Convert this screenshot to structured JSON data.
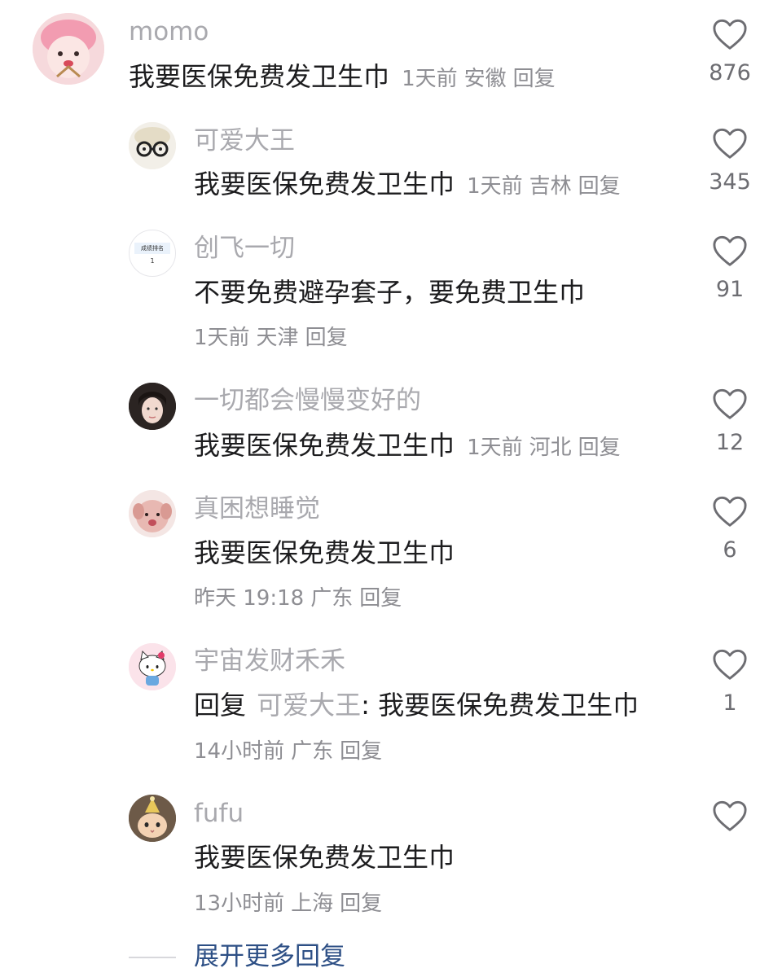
{
  "comments": [
    {
      "username": "momo",
      "avatar": "pink-character-avatar",
      "text": "我要医保免费发卫生巾",
      "time": "1天前",
      "location": "安徽",
      "reply_label": "回复",
      "likes": "876"
    },
    {
      "username": "可爱大王",
      "avatar": "glasses-face-avatar",
      "text": "我要医保免费发卫生巾",
      "time": "1天前",
      "location": "吉林",
      "reply_label": "回复",
      "likes": "345"
    },
    {
      "username": "创飞一切",
      "avatar": "ranking-card-avatar",
      "avatar_card_title": "成绩排名",
      "avatar_card_number": "1",
      "text": "不要免费避孕套子，要免费卫生巾",
      "time": "1天前",
      "location": "天津",
      "reply_label": "回复",
      "likes": "91"
    },
    {
      "username": "一切都会慢慢变好的",
      "avatar": "girl-photo-avatar",
      "text": "我要医保免费发卫生巾",
      "time": "1天前",
      "location": "河北",
      "reply_label": "回复",
      "likes": "12"
    },
    {
      "username": "真困想睡觉",
      "avatar": "pink-dog-avatar",
      "text": "我要医保免费发卫生巾",
      "time": "昨天 19:18",
      "location": "广东",
      "reply_label": "回复",
      "likes": "6"
    },
    {
      "username": "宇宙发财禾禾",
      "avatar": "hello-kitty-avatar",
      "reply_prefix": "回复",
      "reply_to": "可爱大王",
      "text": "我要医保免费发卫生巾",
      "time": "14小时前",
      "location": "广东",
      "reply_label": "回复",
      "likes": "1"
    },
    {
      "username": "fufu",
      "avatar": "cat-with-hat-avatar",
      "text": "我要医保免费发卫生巾",
      "time": "13小时前",
      "location": "上海",
      "reply_label": "回复",
      "likes": ""
    }
  ],
  "expand_label": "展开更多回复",
  "colors": {
    "username": "#a9a9ae",
    "text": "#1c1c1e",
    "meta": "#8e8e93",
    "link": "#2d4f85"
  }
}
